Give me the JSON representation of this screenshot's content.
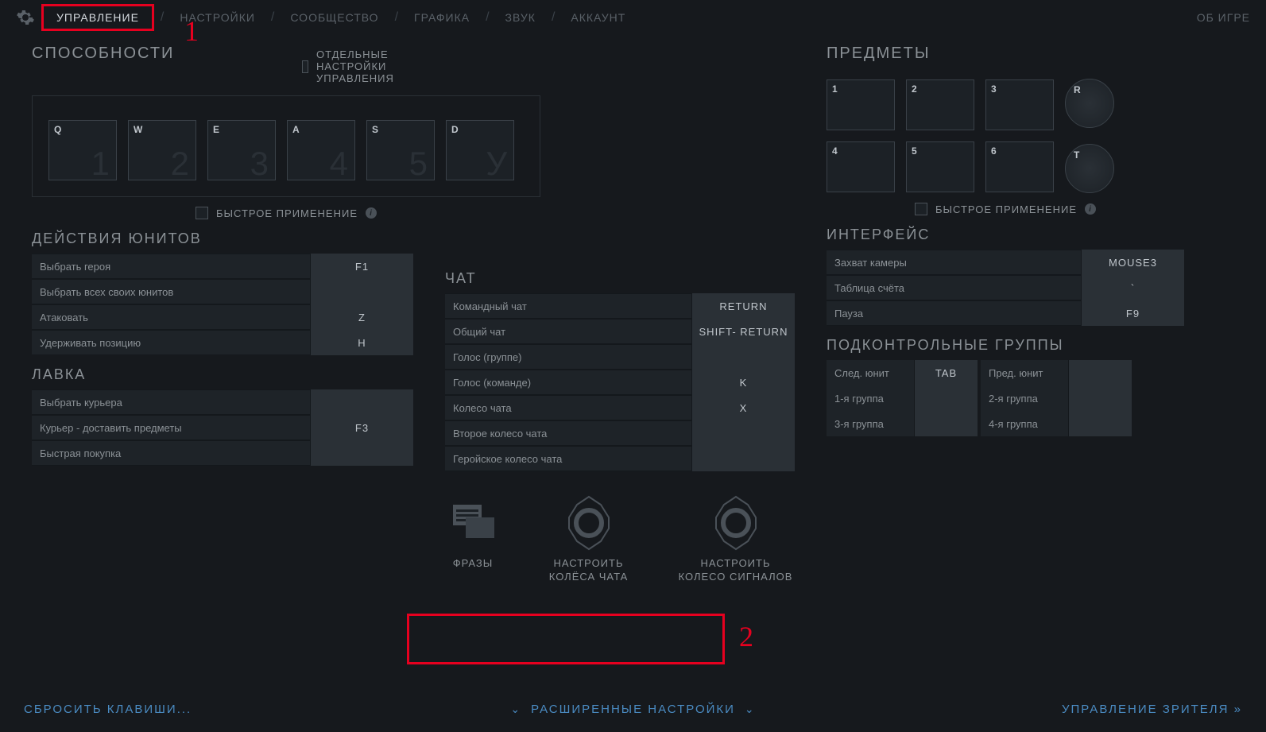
{
  "topbar": {
    "tabs": [
      "УПРАВЛЕНИЕ",
      "НАСТРОЙКИ",
      "СООБЩЕСТВО",
      "ГРАФИКА",
      "ЗВУК",
      "АККАУНТ"
    ],
    "active_index": 0,
    "about": "ОБ ИГРЕ"
  },
  "annotations": {
    "one": "1",
    "two": "2"
  },
  "abilities": {
    "title": "СПОСОБНОСТИ",
    "separate_controls": "ОТДЕЛЬНЫЕ НАСТРОЙКИ УПРАВЛЕНИЯ",
    "slots": [
      {
        "key": "Q",
        "num": "1"
      },
      {
        "key": "W",
        "num": "2"
      },
      {
        "key": "E",
        "num": "3"
      },
      {
        "key": "A",
        "num": "4"
      },
      {
        "key": "S",
        "num": "5"
      },
      {
        "key": "D",
        "num": "У"
      }
    ],
    "quickcast": "БЫСТРОЕ ПРИМЕНЕНИЕ"
  },
  "items": {
    "title": "ПРЕДМЕТЫ",
    "slots": [
      "1",
      "2",
      "3",
      "4",
      "5",
      "6"
    ],
    "round": [
      "R",
      "T"
    ],
    "quickcast": "БЫСТРОЕ ПРИМЕНЕНИЕ"
  },
  "unit_actions": {
    "title": "ДЕЙСТВИЯ ЮНИТОВ",
    "rows": [
      {
        "label": "Выбрать героя",
        "key": "F1"
      },
      {
        "label": "Выбрать всех своих юнитов",
        "key": ""
      },
      {
        "label": "Атаковать",
        "key": "Z"
      },
      {
        "label": "Удерживать позицию",
        "key": "H"
      }
    ]
  },
  "shop": {
    "title": "ЛАВКА",
    "rows": [
      {
        "label": "Выбрать курьера",
        "key": ""
      },
      {
        "label": "Курьер - доставить предметы",
        "key": "F3"
      },
      {
        "label": "Быстрая покупка",
        "key": ""
      }
    ]
  },
  "chat": {
    "title": "ЧАТ",
    "rows": [
      {
        "label": "Командный чат",
        "key": "RETURN"
      },
      {
        "label": "Общий чат",
        "key": "SHIFT- RETURN"
      },
      {
        "label": "Голос (группе)",
        "key": ""
      },
      {
        "label": "Голос (команде)",
        "key": "K"
      },
      {
        "label": "Колесо чата",
        "key": "X"
      },
      {
        "label": "Второе колесо чата",
        "key": ""
      },
      {
        "label": "Геройское колесо чата",
        "key": ""
      }
    ]
  },
  "chat_icons": {
    "phrases": "ФРАЗЫ",
    "wheels": "НАСТРОИТЬ КОЛЁСА ЧАТА",
    "signals": "НАСТРОИТЬ КОЛЕСО СИГНАЛОВ"
  },
  "interface": {
    "title": "ИНТЕРФЕЙС",
    "rows": [
      {
        "label": "Захват камеры",
        "key": "MOUSE3"
      },
      {
        "label": "Таблица счёта",
        "key": "`"
      },
      {
        "label": "Пауза",
        "key": "F9"
      }
    ]
  },
  "groups": {
    "title": "ПОДКОНТРОЛЬНЫЕ ГРУППЫ",
    "rows": [
      [
        {
          "label": "След. юнит",
          "key": "TAB"
        },
        {
          "label": "Пред. юнит",
          "key": ""
        }
      ],
      [
        {
          "label": "1-я группа",
          "key": ""
        },
        {
          "label": "2-я группа",
          "key": ""
        }
      ],
      [
        {
          "label": "3-я группа",
          "key": ""
        },
        {
          "label": "4-я группа",
          "key": ""
        }
      ]
    ]
  },
  "bottom": {
    "reset": "СБРОСИТЬ КЛАВИШИ...",
    "advanced": "РАСШИРЕННЫЕ НАСТРОЙКИ",
    "spectator": "УПРАВЛЕНИЕ ЗРИТЕЛЯ"
  }
}
